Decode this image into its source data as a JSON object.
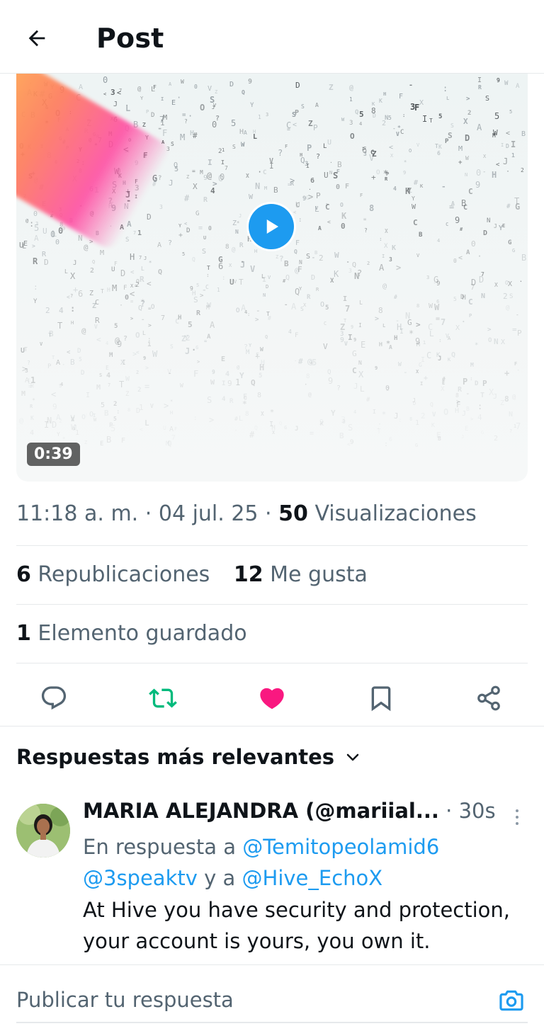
{
  "header": {
    "title": "Post",
    "back_icon": "arrow-left-icon"
  },
  "media": {
    "duration": "0:39",
    "play_icon": "play-icon"
  },
  "meta": {
    "time": "11:18 a. m.",
    "separator": "·",
    "date": "04 jul. 25",
    "views_count": "50",
    "views_label": "Visualizaciones"
  },
  "stats": {
    "reposts_count": "6",
    "reposts_label": "Republicaciones",
    "likes_count": "12",
    "likes_label": "Me gusta",
    "bookmarks_count": "1",
    "bookmarks_label": "Elemento guardado"
  },
  "actions": [
    {
      "icon": "reply-icon"
    },
    {
      "icon": "repost-icon",
      "color": "#00ba7c"
    },
    {
      "icon": "heart-icon",
      "color": "#f91880"
    },
    {
      "icon": "bookmark-icon"
    },
    {
      "icon": "share-icon"
    }
  ],
  "replies_section": {
    "sort_label": "Respuestas más relevantes",
    "sort_icon": "chevron-down-icon"
  },
  "reply": {
    "name": "MARIA ALEJANDRA (@mariial...",
    "time": "· 30s",
    "in_reply_prefix": "En respuesta a",
    "mention_1": "@Temitopeolamid6",
    "mention_2": "@3speaktv",
    "conjunction": "y a",
    "mention_3": "@Hive_EchoX",
    "text": "At Hive you have security and protection, your account is yours, you own it."
  },
  "compose": {
    "placeholder": "Publicar tu respuesta",
    "camera_icon": "camera-icon"
  },
  "colors": {
    "accent": "#1d9bf0",
    "like": "#f91880",
    "repost": "#00ba7c",
    "secondary_text": "#536471"
  }
}
